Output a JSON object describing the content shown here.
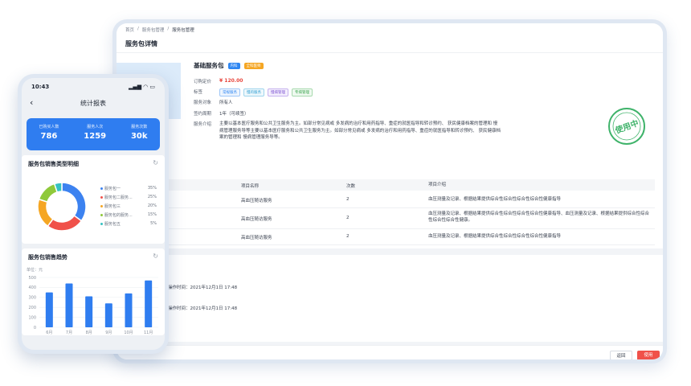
{
  "tablet": {
    "breadcrumb": [
      "首页",
      "服务包管理",
      "服务包管理"
    ],
    "page_title": "服务包详情",
    "package": {
      "name": "基础服务包",
      "tags": [
        "内科",
        "全科医师"
      ],
      "price_label": "订购定价",
      "price": "¥ 120.00",
      "label_label": "标签",
      "labels": [
        "常规服务",
        "慢的服务",
        "慢病管理",
        "专病管理"
      ],
      "target_label": "服务对象",
      "target": "所有人",
      "period_label": "签约周期",
      "period": "1年（可续签）",
      "intro_label": "服务介绍",
      "intro": "主要以基本医疗服务和公共卫生服务为主。如部分常见病或 多发病的治疗和用药指导、重症的就医指导和转诊预约、 获民健康档案的管理和 慢病管理服务导等主要以基本医疗服务和公共卫生服务为主。如部分常见病或 多发病的治疗和用药指导、重症的就医指导和转诊预约、 获民健康档案的管理和 慢病管理服务导等。",
      "stamp": "使用中"
    },
    "table": {
      "headers": [
        "项目名称",
        "次数",
        "项目介绍"
      ],
      "rows": [
        {
          "name": "高血压随访服务",
          "times": "2",
          "intro": "血压测量及记录、根据结果提供综合性综合性综合性综合性健康指导"
        },
        {
          "name": "高血压随访服务",
          "times": "2",
          "intro": "血压测量及记录、根据结果提供综合性综合性综合性综合性健康指导、血压测量及记录、根据结果提供综合性综合性综合性综合性健康。"
        },
        {
          "name": "高血压随访服务",
          "times": "2",
          "intro": "血压测量及记录、根据结果提供综合性综合性综合性综合性健康指导"
        }
      ]
    },
    "logs": [
      "操作时间：2021年12月1日 17:48",
      "操作时间：2021年12月1日 17:48"
    ],
    "buttons": {
      "back": "返回",
      "use": "使用"
    }
  },
  "phone": {
    "time": "10:43",
    "title": "统计报表",
    "stats": [
      {
        "label": "已购买人数",
        "value": "786"
      },
      {
        "label": "服务人次",
        "value": "1259"
      },
      {
        "label": "服务次数",
        "value": "30k"
      }
    ],
    "pie_title": "服务包销售类型明细",
    "bar_title": "服务包销售趋势"
  },
  "chart_data": [
    {
      "type": "pie",
      "categories": [
        "服务包一",
        "服务包二服务...",
        "服务包三",
        "服务包的服务...",
        "服务包五"
      ],
      "values": [
        35,
        25,
        20,
        15,
        5
      ],
      "value_labels": [
        "35%",
        "25%",
        "20%",
        "15%",
        "5%"
      ],
      "colors": [
        "#3c82f0",
        "#f0514a",
        "#f5a623",
        "#8fc93a",
        "#36c2c2"
      ]
    },
    {
      "type": "bar",
      "ylabel": "单位：元",
      "categories": [
        "6月",
        "7月",
        "8月",
        "9月",
        "10月",
        "11月"
      ],
      "values": [
        350,
        440,
        310,
        240,
        340,
        470
      ],
      "ylim": [
        0,
        500
      ],
      "yticks": [
        0,
        100,
        200,
        300,
        400,
        500
      ],
      "color": "#2f7df0"
    }
  ],
  "colors": {
    "accent": "#2f7df0",
    "danger": "#f0514a"
  }
}
